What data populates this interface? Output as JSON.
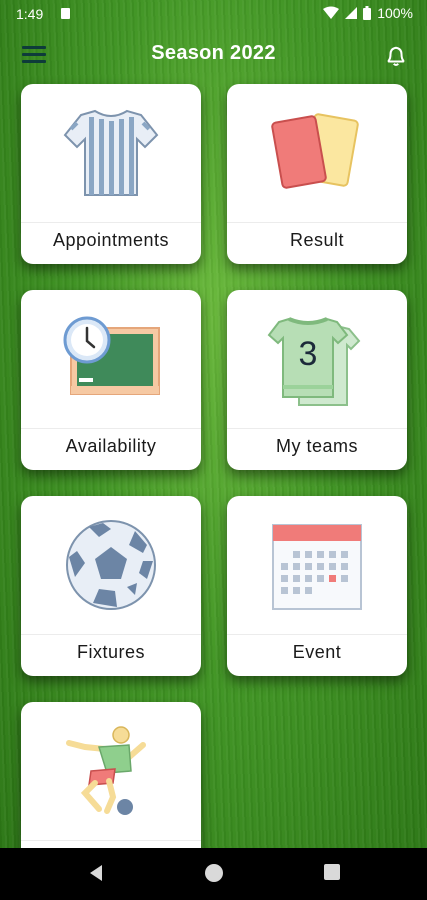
{
  "status": {
    "time": "1:49",
    "battery": "100%"
  },
  "header": {
    "title": "Season 2022"
  },
  "tiles": [
    {
      "id": "appointments",
      "label": "Appointments",
      "icon": "referee-shirt-icon"
    },
    {
      "id": "result",
      "label": "Result",
      "icon": "cards-icon"
    },
    {
      "id": "availability",
      "label": "Availability",
      "icon": "clock-board-icon"
    },
    {
      "id": "my-teams",
      "label": "My teams",
      "icon": "team-shirt-icon",
      "number": "3"
    },
    {
      "id": "fixtures",
      "label": "Fixtures",
      "icon": "soccer-ball-icon"
    },
    {
      "id": "event",
      "label": "Event",
      "icon": "calendar-icon"
    },
    {
      "id": "player",
      "label": "",
      "icon": "player-kick-icon"
    }
  ],
  "colors": {
    "accent": "#f07b79",
    "shirt_blue": "#8aa6c4",
    "board_green": "#3f8a5a",
    "team_green": "#9bd29a"
  }
}
